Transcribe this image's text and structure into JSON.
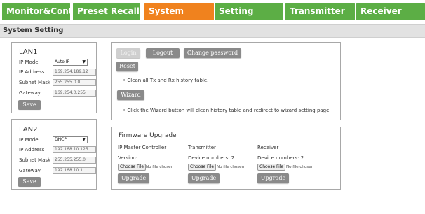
{
  "nav": {
    "tabs": [
      {
        "label": "Monitor&Control"
      },
      {
        "label": "Preset Recall"
      },
      {
        "label": "System"
      },
      {
        "label": "Setting"
      },
      {
        "label": "Transmitter"
      },
      {
        "label": "Receiver"
      }
    ],
    "active_tab": "System"
  },
  "section_title": "System Setting",
  "lan1": {
    "title": "LAN1",
    "ip_mode_label": "IP Mode",
    "ip_mode_value": "Auto IP",
    "ip_address_label": "IP Address",
    "ip_address_value": "169.254.189.12",
    "subnet_label": "Subnet Mask",
    "subnet_value": "255.255.0.0",
    "gateway_label": "Gateway",
    "gateway_value": "169.254.0.255",
    "save_label": "Save"
  },
  "lan2": {
    "title": "LAN2",
    "ip_mode_label": "IP Mode",
    "ip_mode_value": "DHCP",
    "ip_address_label": "IP Address",
    "ip_address_value": "192.168.10.125",
    "subnet_label": "Subnet Mask",
    "subnet_value": "255.255.255.0",
    "gateway_label": "Gateway",
    "gateway_value": "192.168.10.1",
    "save_label": "Save"
  },
  "account": {
    "login_label": "Login",
    "logout_label": "Logout",
    "change_password_label": "Change password",
    "reset_label": "Reset",
    "reset_note": "Clean all Tx and Rx history table.",
    "wizard_label": "Wizard",
    "wizard_note": "Click the Wizard button will clean history table and redirect to wizard setting page."
  },
  "firmware": {
    "title": "Firmware Upgrade",
    "columns": [
      {
        "header": "IP Master Controller",
        "sub": "Version:",
        "choose_label": "Choose File",
        "no_file": "No file chosen",
        "upgrade_label": "Upgrade"
      },
      {
        "header": "Transmitter",
        "sub": "Device numbers: 2",
        "choose_label": "Choose File",
        "no_file": "No file chosen",
        "upgrade_label": "Upgrade"
      },
      {
        "header": "Receiver",
        "sub": "Device numbers: 2",
        "choose_label": "Choose File",
        "no_file": "No file chosen",
        "upgrade_label": "Upgrade"
      }
    ]
  },
  "colors": {
    "tab_green": "#5cae45",
    "tab_active_orange": "#f0821e",
    "button_gray": "#8a8a8a"
  }
}
